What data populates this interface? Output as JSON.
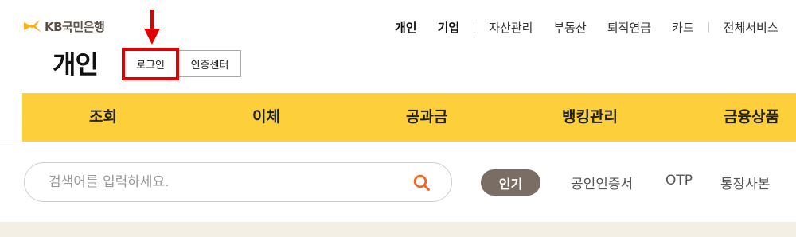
{
  "brand": {
    "logo_text": "KB국민은행",
    "mark_color": "#fcaf17"
  },
  "top_nav": {
    "personal": "개인",
    "corporate": "기업",
    "asset": "자산관리",
    "realestate": "부동산",
    "pension": "퇴직연금",
    "card": "카드",
    "all_services": "전체서비스"
  },
  "header": {
    "title": "개인",
    "login_button": "로그인",
    "cert_center_button": "인증센터"
  },
  "gnb": {
    "items": [
      "조회",
      "이체",
      "공과금",
      "뱅킹관리",
      "금융상품"
    ]
  },
  "search": {
    "placeholder": "검색어를 입력하세요.",
    "popular_badge": "인기",
    "keywords": [
      "공인인증서",
      "OTP",
      "통장사본"
    ]
  },
  "colors": {
    "gnb_bg": "#fdd03b",
    "highlight": "#e00000",
    "search_icon": "#f26522",
    "badge_bg": "#7a6e64"
  }
}
